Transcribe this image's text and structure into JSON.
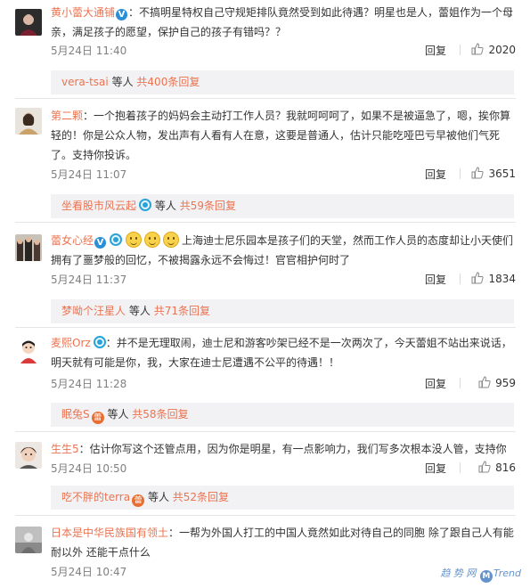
{
  "comments": [
    {
      "user": "黄小蕾大通铺",
      "has_vip": true,
      "text": "：不搞明星特权自己守规矩排队竟然受到如此待遇？明星也是人，蕾姐作为一个母亲，满足孩子的愿望，保护自己的孩子有错吗？？",
      "time": "5月24日 11:40",
      "reply_label": "回复",
      "likes": "2020",
      "sub_user": "vera-tsai",
      "sub_text": "等人",
      "sub_count": "共400条回复"
    },
    {
      "user": "第二颗",
      "text": "：一个抱着孩子的妈妈会主动打工作人员？我就呵呵呵了，如果不是被逼急了，嗯，挨你算轻的！你是公众人物，发出声有人看有人在意，这要是普通人，估计只能吃哑巴亏早被他们气死了。支持你投诉。",
      "time": "5月24日 11:07",
      "reply_label": "回复",
      "likes": "3651",
      "sub_user": "坐看股市风云起",
      "sub_text": "等人",
      "sub_count": "共59条回复"
    },
    {
      "user": "蕾女心经",
      "has_vip": true,
      "text": "上海迪士尼乐园本是孩子们的天堂，然而工作人员的态度却让小天使们拥有了噩梦般的回忆，不被揭露永远不会悔过！官官相护何时了",
      "time": "5月24日 11:37",
      "reply_label": "回复",
      "likes": "1834",
      "sub_user": "梦呦个汪星人",
      "sub_text": "等人",
      "sub_count": "共71条回复"
    },
    {
      "user": "麦熙Orz",
      "text": "：并不是无理取闹，迪士尼和游客吵架已经不是一次两次了，今天蕾姐不站出来说话，明天就有可能是你，我，大家在迪士尼遭遇不公平的待遇！！",
      "time": "5月24日 11:28",
      "reply_label": "回复",
      "likes": "959",
      "sub_user": "眠兔S",
      "sub_text": "等人",
      "sub_count": "共58条回复"
    },
    {
      "user": "生生5",
      "text": "：估计你写这个还管点用，因为你是明星，有一点影响力，我们写多次根本没人管，支持你",
      "time": "5月24日 10:50",
      "reply_label": "回复",
      "likes": "816",
      "sub_user": "吃不胖的terra",
      "sub_text": "等人",
      "sub_count": "共52条回复"
    },
    {
      "user": "日本是中华民族国有领土",
      "text": "：一帮为外国人打工的中国人竟然如此对待自己的同胞 除了跟自己人有能耐以外 还能干点什么",
      "time": "5月24日 10:47"
    }
  ],
  "watermark": {
    "prefix": "趋 势 网",
    "brand": "Trend"
  },
  "colors": {
    "username": "#eb7350",
    "subbar_bg": "#f2f2f5",
    "vip": "#2b8fd6"
  }
}
